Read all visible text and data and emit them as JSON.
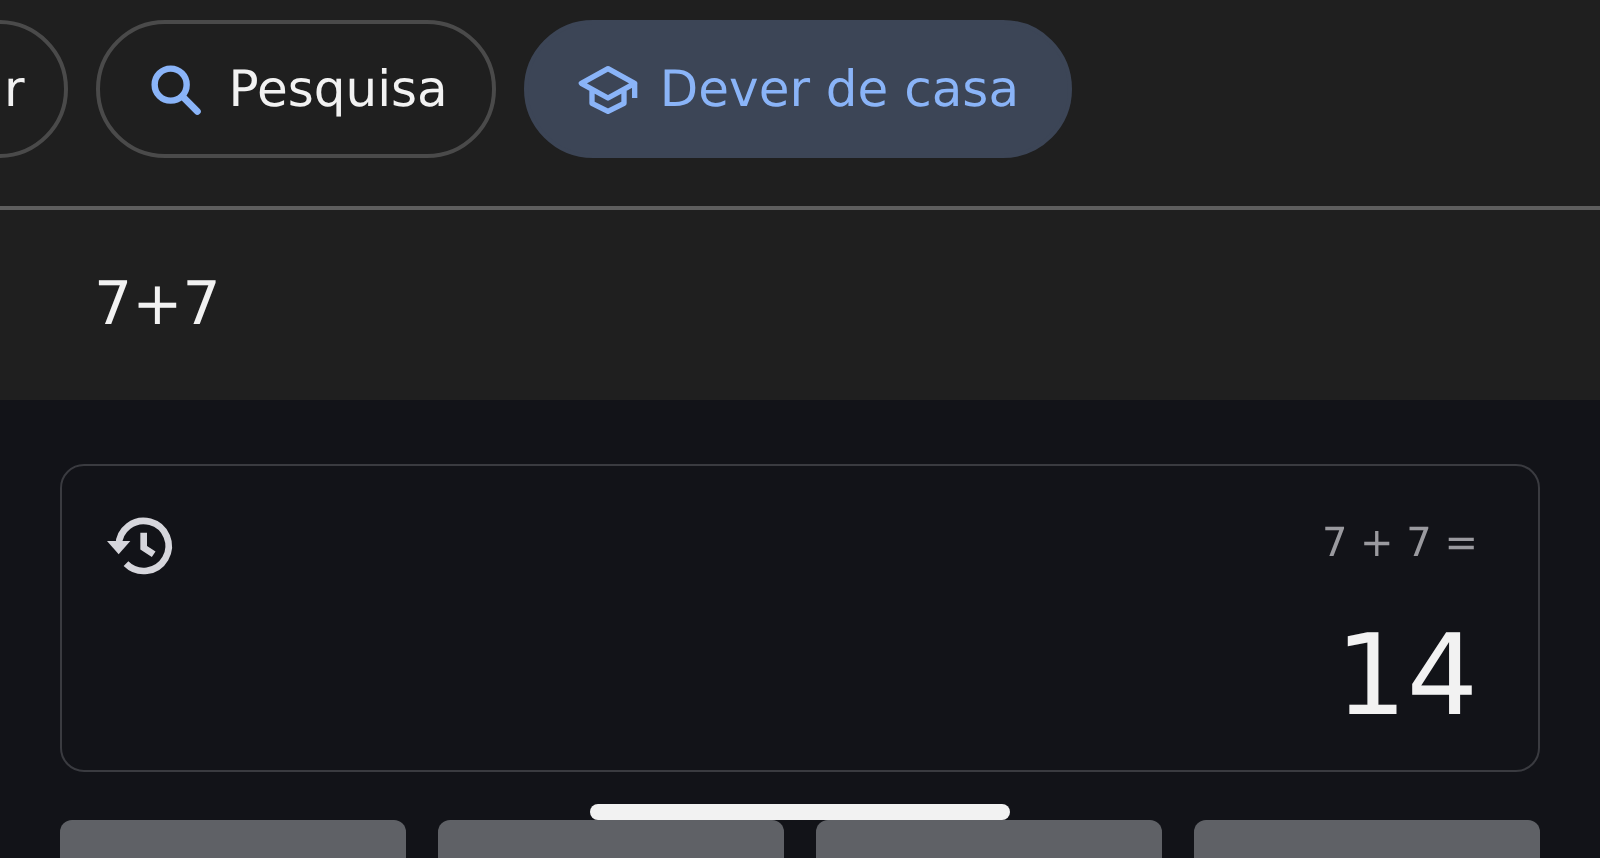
{
  "chips": [
    {
      "label": "r",
      "kind": "text",
      "selected": false
    },
    {
      "label": "Pesquisa",
      "kind": "search",
      "selected": false
    },
    {
      "label": "Dever de casa",
      "kind": "homework",
      "selected": true
    }
  ],
  "query": "7+7",
  "calculator": {
    "expression": "7 + 7 =",
    "result": "14"
  },
  "keys": [
    {
      "kind": "key"
    },
    {
      "kind": "key"
    },
    {
      "kind": "key"
    },
    {
      "kind": "key"
    }
  ]
}
